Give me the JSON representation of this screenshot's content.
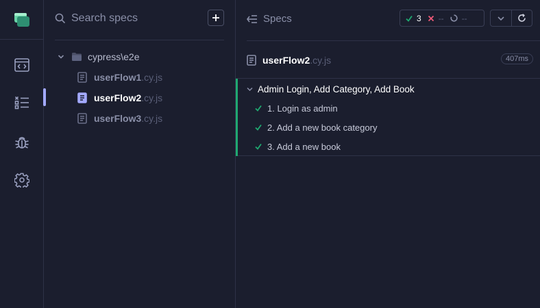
{
  "sidebar": {
    "items": [
      {
        "name": "specs",
        "icon": "code-window-icon"
      },
      {
        "name": "runs",
        "icon": "test-list-icon"
      },
      {
        "name": "debug",
        "icon": "bug-icon"
      },
      {
        "name": "settings",
        "icon": "gear-icon"
      }
    ],
    "active": "runs"
  },
  "search": {
    "placeholder": "Search specs",
    "value": ""
  },
  "tree": {
    "folder": "cypress\\e2e",
    "files": [
      {
        "name": "userFlow1",
        "ext": ".cy.js",
        "active": false
      },
      {
        "name": "userFlow2",
        "ext": ".cy.js",
        "active": true
      },
      {
        "name": "userFlow3",
        "ext": ".cy.js",
        "active": false
      }
    ]
  },
  "runner": {
    "title": "Specs",
    "stats": {
      "passed": "3",
      "failed": "--",
      "pending": "--"
    },
    "spec": {
      "name": "userFlow2",
      "ext": ".cy.js",
      "duration": "407ms"
    },
    "suite": {
      "title": "Admin Login, Add Category, Add Book",
      "tests": [
        {
          "label": "1. Login as admin",
          "state": "passed"
        },
        {
          "label": "2. Add a new book category",
          "state": "passed"
        },
        {
          "label": "3. Add a new book",
          "state": "passed"
        }
      ]
    }
  },
  "colors": {
    "background": "#1b1e2e",
    "accent": "#a3a9ff",
    "pass": "#1fa971",
    "fail": "#ef5a78",
    "logo": "#69d3a7"
  }
}
